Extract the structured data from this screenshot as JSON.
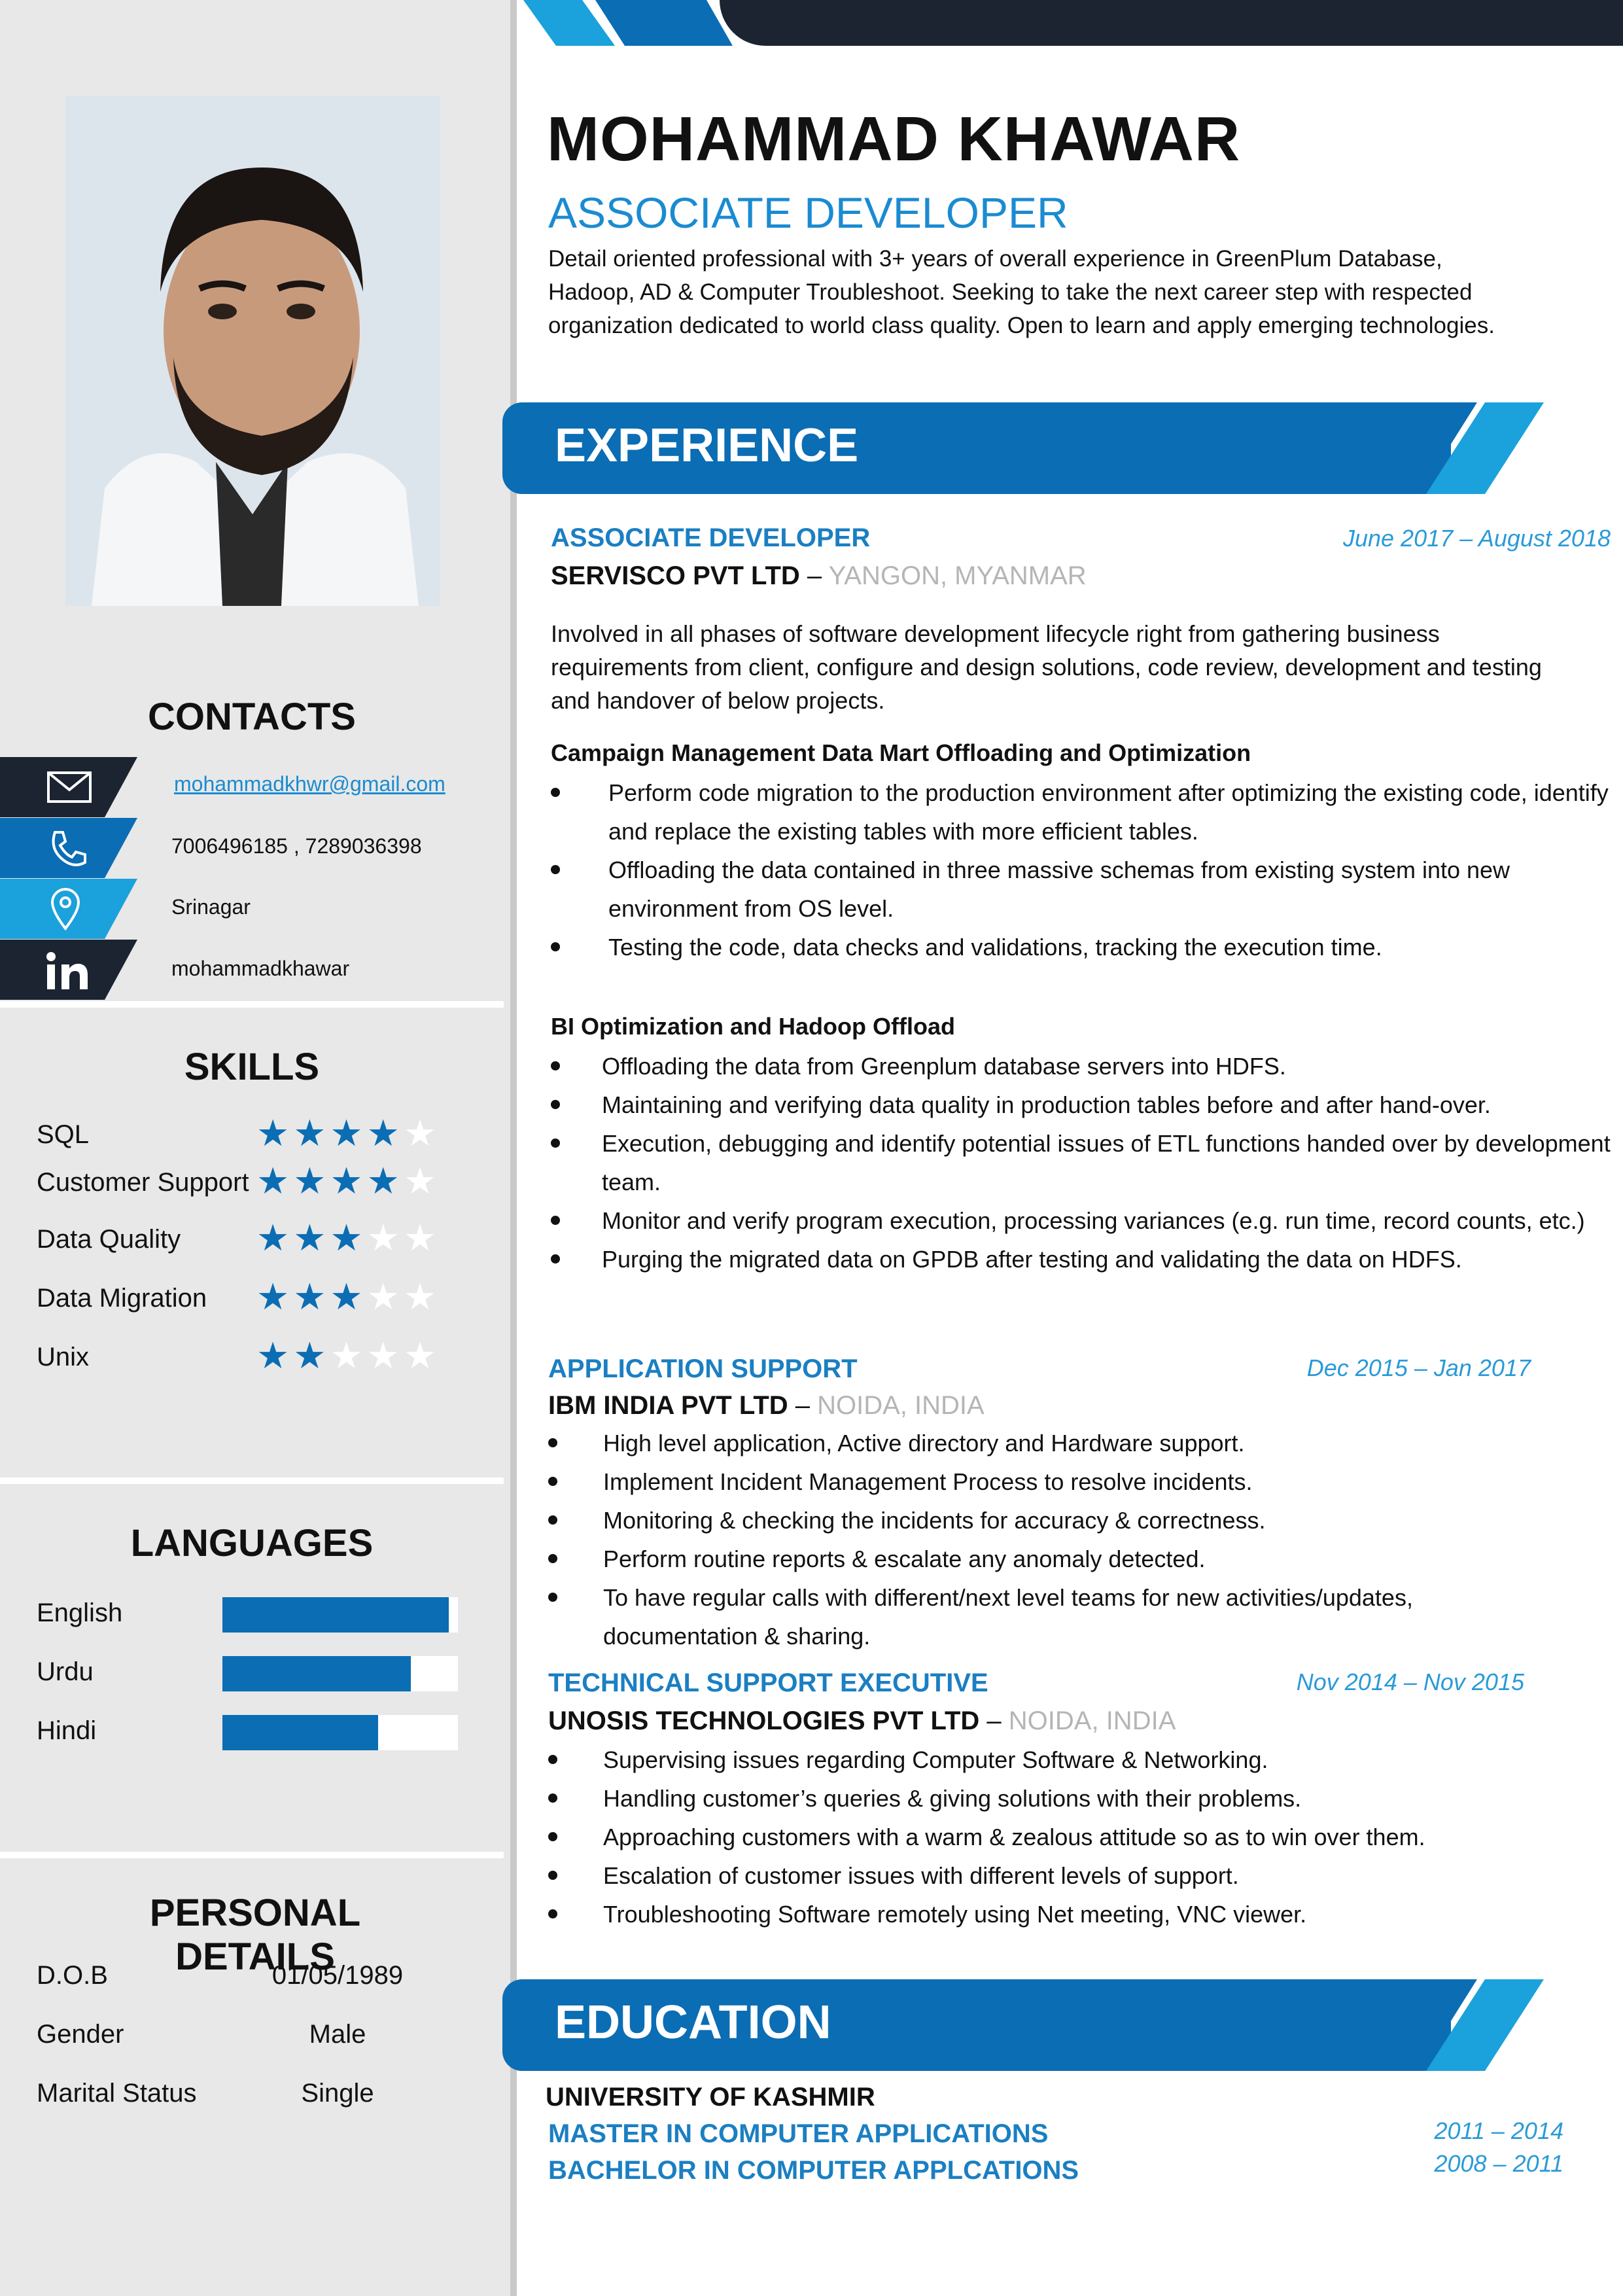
{
  "header": {
    "name": "MOHAMMAD KHAWAR",
    "role": "ASSOCIATE DEVELOPER",
    "summary": "Detail oriented professional with 3+ years of overall experience in GreenPlum Database, Hadoop, AD & Computer Troubleshoot. Seeking to take the next career step with respected organization dedicated to world class quality. Open to learn and apply emerging technologies."
  },
  "colors": {
    "accent": "#0b6db4",
    "accent_light": "#1ba1db",
    "dark": "#1b2430",
    "sidebar": "#e8e8e8"
  },
  "contacts": {
    "title": "CONTACTS",
    "items": [
      {
        "icon": "email-icon",
        "value": "mohammadkhwr@gmail.com"
      },
      {
        "icon": "phone-icon",
        "value": "7006496185 , 7289036398"
      },
      {
        "icon": "location-pin-icon",
        "value": "Srinagar"
      },
      {
        "icon": "linkedin-icon",
        "value": "mohammadkhawar"
      }
    ]
  },
  "skills": {
    "title": "SKILLS",
    "items": [
      {
        "name": "SQL",
        "rating": 4,
        "max": 5
      },
      {
        "name": "Customer Support",
        "rating": 4,
        "max": 5
      },
      {
        "name": "Data Quality",
        "rating": 3,
        "max": 5
      },
      {
        "name": "Data Migration",
        "rating": 3,
        "max": 5
      },
      {
        "name": "Unix",
        "rating": 2,
        "max": 5
      }
    ]
  },
  "languages": {
    "title": "LANGUAGES",
    "items": [
      {
        "name": "English",
        "level": 0.96
      },
      {
        "name": "Urdu",
        "level": 0.8
      },
      {
        "name": "Hindi",
        "level": 0.66
      }
    ]
  },
  "personal": {
    "title": "PERSONAL DETAILS",
    "items": [
      {
        "label": "D.O.B",
        "value": "01/05/1989"
      },
      {
        "label": "Gender",
        "value": "Male"
      },
      {
        "label": "Marital Status",
        "value": "Single"
      }
    ]
  },
  "experience": {
    "title": "EXPERIENCE",
    "job1": {
      "title": "ASSOCIATE DEVELOPER",
      "company": "SERVISCO PVT LTD",
      "sep": " – ",
      "location": "YANGON, MYANMAR",
      "dates": "June 2017 – August 2018",
      "description": "Involved in all phases of software development lifecycle right from gathering business requirements from client, configure and design solutions, code review,  development and testing and handover of below projects.",
      "project1": {
        "title": "Campaign Management Data Mart Offloading and Optimization",
        "bullets": [
          "Perform code migration to the production environment after optimizing the existing code, identify and replace the existing tables with more efficient tables.",
          "Offloading the data contained in three massive schemas from existing system into new environment from OS level.",
          "Testing the code, data checks and validations, tracking the execution time."
        ]
      },
      "project2": {
        "title": "BI Optimization and Hadoop Offload",
        "bullets": [
          "Offloading the data from Greenplum database servers into HDFS.",
          "Maintaining and verifying data quality in production tables before and after hand-over.",
          "Execution, debugging and identify potential issues of ETL functions handed over by development team.",
          "Monitor and verify program execution, processing variances (e.g. run time, record counts, etc.)",
          "Purging the migrated data on GPDB after testing and validating the data on HDFS."
        ]
      }
    },
    "job2": {
      "title": "APPLICATION SUPPORT",
      "company": "IBM INDIA PVT LTD",
      "sep": " – ",
      "location": "NOIDA, INDIA",
      "dates": "Dec 2015 – Jan 2017",
      "bullets": [
        "High level application, Active directory and Hardware support.",
        "Implement Incident Management Process to resolve incidents.",
        "Monitoring & checking the incidents for accuracy & correctness.",
        "Perform routine reports & escalate any anomaly detected.",
        "To have regular calls with different/next level teams for new activities/updates, documentation & sharing."
      ]
    },
    "job3": {
      "title": "TECHNICAL SUPPORT EXECUTIVE",
      "company": "UNOSIS TECHNOLOGIES PVT LTD",
      "sep": " – ",
      "location": "NOIDA, INDIA",
      "dates": "Nov 2014 – Nov 2015",
      "bullets": [
        "Supervising issues regarding Computer Software & Networking.",
        "Handling customer’s queries & giving solutions with their problems.",
        "Approaching customers with a warm & zealous attitude so as to win over them.",
        "Escalation of customer issues with different levels of support.",
        "Troubleshooting Software remotely using Net meeting, VNC viewer."
      ]
    }
  },
  "education": {
    "title": "EDUCATION",
    "university": "UNIVERSITY OF KASHMIR",
    "degree1": "MASTER IN COMPUTER APPLICATIONS",
    "degree2": "BACHELOR IN COMPUTER APPLCATIONS",
    "dates1": "2011 – 2014",
    "dates2": "2008 – 2011"
  }
}
